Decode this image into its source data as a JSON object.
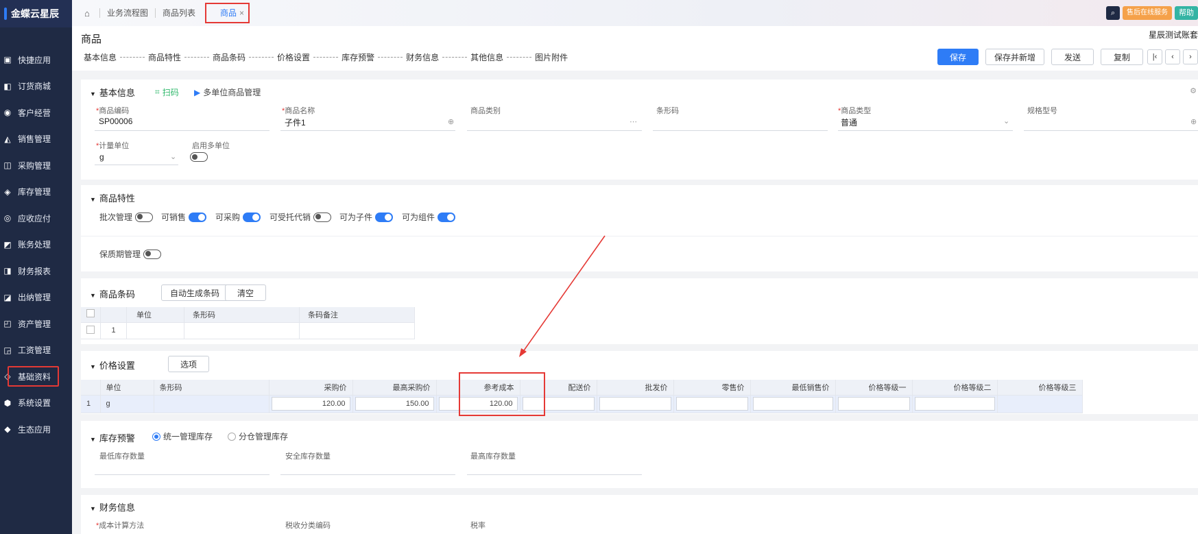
{
  "sidebar": {
    "logo": "金蝶云星辰",
    "items": [
      {
        "label": "快捷应用",
        "icon": "▣"
      },
      {
        "label": "订货商城",
        "icon": "◧"
      },
      {
        "label": "客户经营",
        "icon": "◉"
      },
      {
        "label": "销售管理",
        "icon": "◭"
      },
      {
        "label": "采购管理",
        "icon": "◫"
      },
      {
        "label": "库存管理",
        "icon": "◈"
      },
      {
        "label": "应收应付",
        "icon": "◎"
      },
      {
        "label": "账务处理",
        "icon": "◩"
      },
      {
        "label": "财务报表",
        "icon": "◨"
      },
      {
        "label": "出纳管理",
        "icon": "◪"
      },
      {
        "label": "资产管理",
        "icon": "◰"
      },
      {
        "label": "工资管理",
        "icon": "◲"
      },
      {
        "label": "基础资料",
        "icon": "◇"
      },
      {
        "label": "系统设置",
        "icon": "⬢"
      },
      {
        "label": "生态应用",
        "icon": "◆"
      }
    ]
  },
  "topbar": {
    "tabs": [
      "业务流程图",
      "商品列表"
    ],
    "active_tab": "商品",
    "close": "×",
    "service": "售后在线服务",
    "help": "帮助"
  },
  "header": {
    "title": "商品",
    "account": "星辰测试账套",
    "steps": [
      "基本信息",
      "商品特性",
      "商品条码",
      "价格设置",
      "库存预警",
      "财务信息",
      "其他信息",
      "图片附件"
    ],
    "buttons": {
      "save": "保存",
      "save_new": "保存并新增",
      "send": "发送",
      "copy": "复制"
    }
  },
  "basic": {
    "title": "基本信息",
    "scan": "扫码",
    "multi_unit": "多单位商品管理",
    "fields": {
      "code_label": "商品编码",
      "code_value": "SP00006",
      "name_label": "商品名称",
      "name_value": "子件1",
      "category_label": "商品类别",
      "barcode_label": "条形码",
      "type_label": "商品类型",
      "type_value": "普通",
      "spec_label": "规格型号",
      "unit_label": "计量单位",
      "unit_value": "g",
      "multi_unit_label": "启用多单位"
    }
  },
  "features": {
    "title": "商品特性",
    "items": [
      {
        "label": "批次管理",
        "on": false
      },
      {
        "label": "可销售",
        "on": true
      },
      {
        "label": "可采购",
        "on": true
      },
      {
        "label": "可受托代销",
        "on": false
      },
      {
        "label": "可为子件",
        "on": true
      },
      {
        "label": "可为组件",
        "on": true
      }
    ],
    "shelf_life": "保质期管理"
  },
  "barcode": {
    "title": "商品条码",
    "auto_btn": "自动生成条码",
    "clear_btn": "清空",
    "columns": [
      "单位",
      "条形码",
      "条码备注"
    ],
    "row_no": "1"
  },
  "price": {
    "title": "价格设置",
    "option_btn": "选项",
    "columns": [
      "单位",
      "条形码",
      "采购价",
      "最高采购价",
      "参考成本",
      "配送价",
      "批发价",
      "零售价",
      "最低销售价",
      "价格等级一",
      "价格等级二",
      "价格等级三"
    ],
    "row": {
      "no": "1",
      "unit": "g",
      "purchase": "120.00",
      "max_purchase": "150.00",
      "ref_cost": "120.00"
    }
  },
  "stock": {
    "title": "库存预警",
    "radio_unified": "统一管理库存",
    "radio_split": "分仓管理库存",
    "min_label": "最低库存数量",
    "safe_label": "安全库存数量",
    "max_label": "最高库存数量"
  },
  "finance": {
    "title": "财务信息",
    "cost_method_label": "成本计算方法",
    "tax_code_label": "税收分类编码",
    "tax_rate_label": "税率"
  },
  "colors": {
    "accent": "#2e7cf6",
    "sidebar": "#1f2a44",
    "annotation": "#e53935"
  }
}
